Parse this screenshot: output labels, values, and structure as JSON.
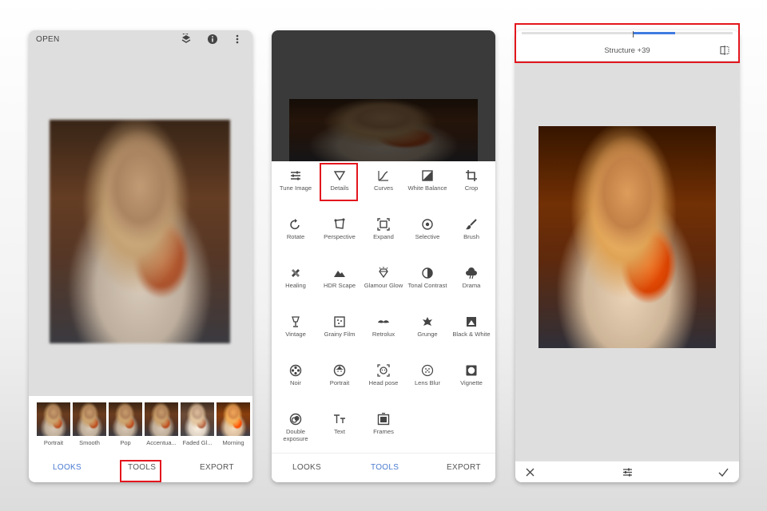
{
  "screen1": {
    "open_label": "OPEN",
    "looks": [
      "Portrait",
      "Smooth",
      "Pop",
      "Accentua...",
      "Faded Gl...",
      "Morning"
    ],
    "nav": {
      "looks": "LOOKS",
      "tools": "TOOLS",
      "export": "EXPORT"
    }
  },
  "screen2": {
    "tools": [
      {
        "label": "Tune Image",
        "icon": "tune-icon"
      },
      {
        "label": "Details",
        "icon": "triangle-icon"
      },
      {
        "label": "Curves",
        "icon": "curves-icon"
      },
      {
        "label": "White Balance",
        "icon": "white-balance-icon"
      },
      {
        "label": "Crop",
        "icon": "crop-icon"
      },
      {
        "label": "Rotate",
        "icon": "rotate-icon"
      },
      {
        "label": "Perspective",
        "icon": "perspective-icon"
      },
      {
        "label": "Expand",
        "icon": "expand-icon"
      },
      {
        "label": "Selective",
        "icon": "selective-icon"
      },
      {
        "label": "Brush",
        "icon": "brush-icon"
      },
      {
        "label": "Healing",
        "icon": "healing-icon"
      },
      {
        "label": "HDR Scape",
        "icon": "mountain-icon"
      },
      {
        "label": "Glamour Glow",
        "icon": "diamond-icon"
      },
      {
        "label": "Tonal Contrast",
        "icon": "contrast-icon"
      },
      {
        "label": "Drama",
        "icon": "cloud-icon"
      },
      {
        "label": "Vintage",
        "icon": "lamp-icon"
      },
      {
        "label": "Grainy Film",
        "icon": "film-icon"
      },
      {
        "label": "Retrolux",
        "icon": "mustache-icon"
      },
      {
        "label": "Grunge",
        "icon": "grunge-icon"
      },
      {
        "label": "Black & White",
        "icon": "bw-icon"
      },
      {
        "label": "Noir",
        "icon": "film-reel-icon"
      },
      {
        "label": "Portrait",
        "icon": "face-icon"
      },
      {
        "label": "Head pose",
        "icon": "head-pose-icon"
      },
      {
        "label": "Lens Blur",
        "icon": "lens-blur-icon"
      },
      {
        "label": "Vignette",
        "icon": "vignette-icon"
      },
      {
        "label": "Double exposure",
        "icon": "double-exposure-icon"
      },
      {
        "label": "Text",
        "icon": "text-icon"
      },
      {
        "label": "Frames",
        "icon": "frames-icon"
      }
    ],
    "nav": {
      "looks": "LOOKS",
      "tools": "TOOLS",
      "export": "EXPORT"
    }
  },
  "screen3": {
    "adjustment_label": "Structure +39",
    "slider_value": 39
  },
  "colors": {
    "accent": "#4a7bd0",
    "highlight": "#e3161d",
    "slider": "#3f7be0"
  }
}
